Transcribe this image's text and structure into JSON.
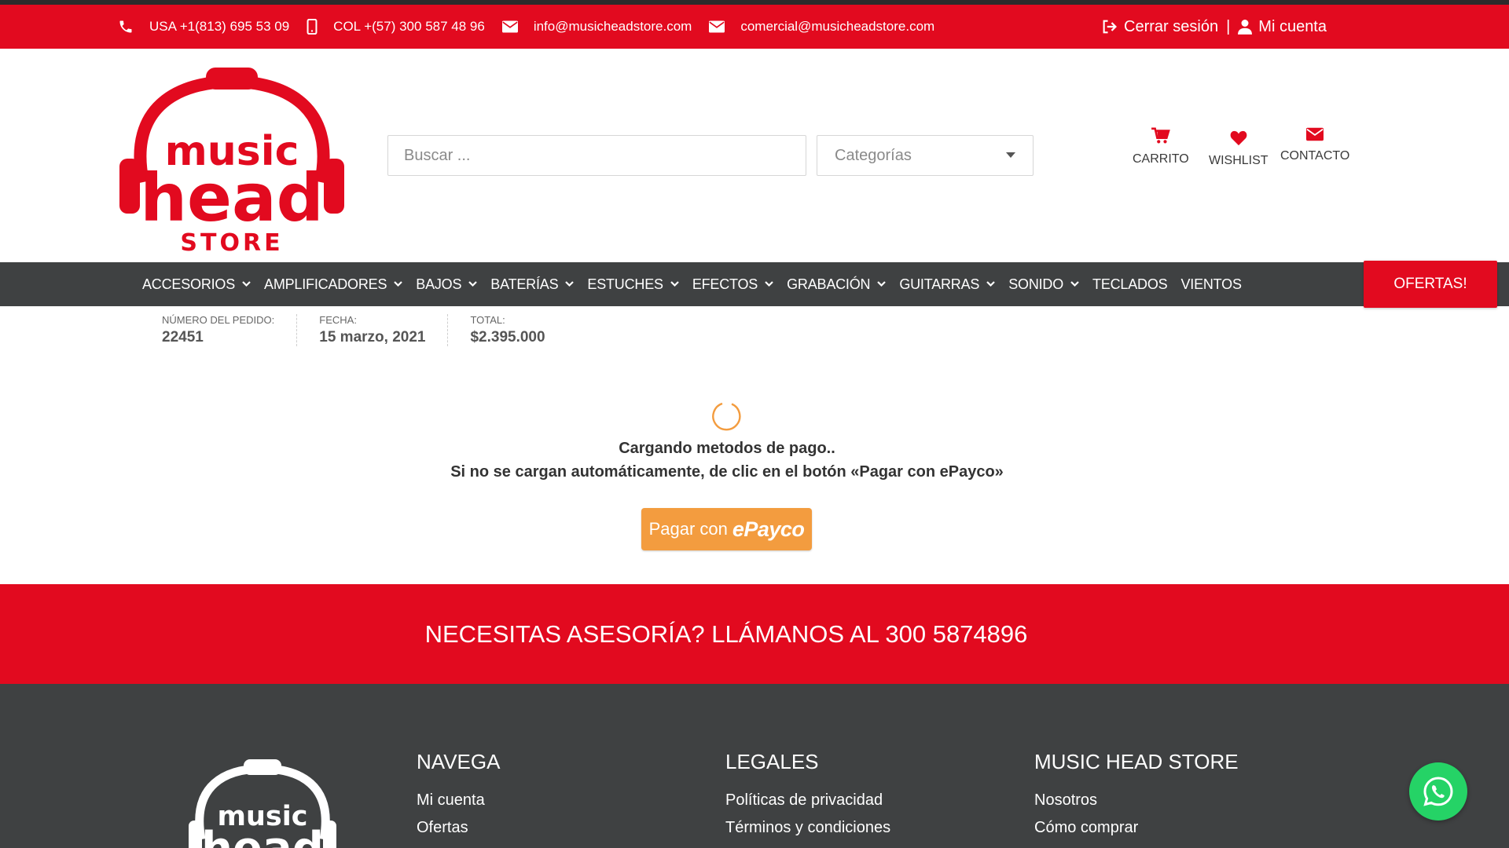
{
  "colors": {
    "brand_red": "#e20a1f",
    "nav_dark": "#3f4142",
    "epayco_orange": "#f39c3f",
    "whatsapp_green": "#25d366"
  },
  "topbar": {
    "phone_usa": "USA +1(813) 695 53 09",
    "phone_col": "COL +(57) 300 587 48 96",
    "email_info": "info@musicheadstore.com",
    "email_comercial": "comercial@musicheadstore.com",
    "logout": "Cerrar sesión",
    "separator": "|",
    "account": "Mi cuenta"
  },
  "logo": {
    "line1": "music",
    "line2": "head",
    "line3": "STORE"
  },
  "search": {
    "placeholder": "Buscar ..."
  },
  "category": {
    "selected": "Categorías"
  },
  "quick_links": {
    "cart": "CARRITO",
    "wishlist": "WISHLIST",
    "contact": "CONTACTO"
  },
  "nav": {
    "items": [
      {
        "label": "ACCESORIOS"
      },
      {
        "label": "AMPLIFICADORES"
      },
      {
        "label": "BAJOS"
      },
      {
        "label": "BATERÍAS"
      },
      {
        "label": "ESTUCHES"
      },
      {
        "label": "EFECTOS"
      },
      {
        "label": "GRABACIÓN"
      },
      {
        "label": "GUITARRAS"
      },
      {
        "label": "SONIDO"
      },
      {
        "label": "TECLADOS"
      },
      {
        "label": "VIENTOS"
      }
    ],
    "offers": "OFERTAS!"
  },
  "order": {
    "number_label": "NÚMERO DEL PEDIDO:",
    "number": "22451",
    "date_label": "FECHA:",
    "date": "15 marzo, 2021",
    "total_label": "TOTAL:",
    "total": "$2.395.000"
  },
  "loading": {
    "title": "Cargando metodos de pago..",
    "subtitle": "Si no se cargan automáticamente, de clic en el botón «Pagar con ePayco»",
    "button_prefix": "Pagar con",
    "button_brand": "ePayco"
  },
  "promo": {
    "text": "NECESITAS ASESORÍA? LLÁMANOS AL 300 5874896"
  },
  "footer": {
    "col1": {
      "title": "NAVEGA",
      "links": [
        "Mi cuenta",
        "Ofertas"
      ]
    },
    "col2": {
      "title": "LEGALES",
      "links": [
        "Políticas de privacidad",
        "Términos y condiciones"
      ]
    },
    "col3": {
      "title": "MUSIC HEAD STORE",
      "links": [
        "Nosotros",
        "Cómo comprar"
      ]
    }
  }
}
